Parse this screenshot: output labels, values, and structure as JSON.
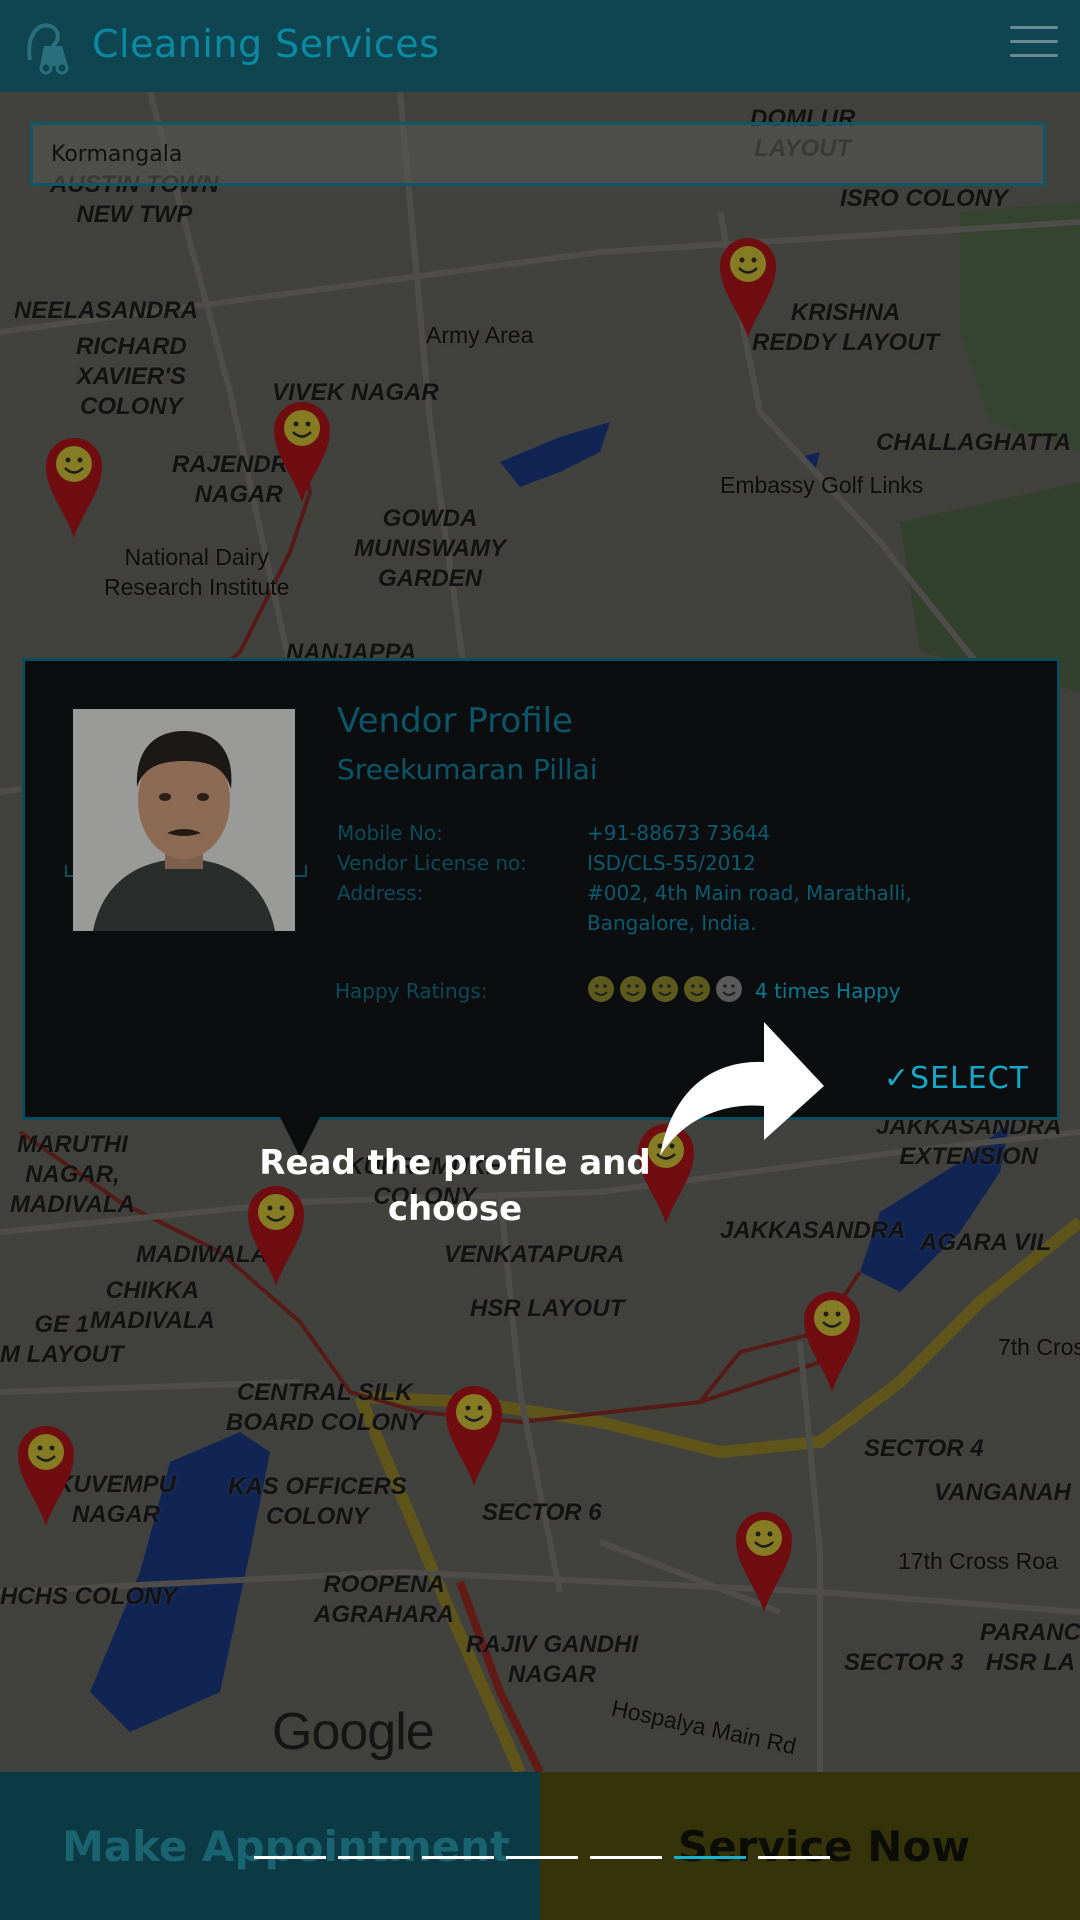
{
  "header": {
    "title": "Cleaning Services"
  },
  "search": {
    "value": "Kormangala"
  },
  "map": {
    "labels": [
      "AUSTIN TOWN\nNEW TWP",
      "ISRO COLONY",
      "DOMLUR\nLAYOUT",
      "NEELASANDRA",
      "RICHARD\nXAVIER'S\nCOLONY",
      "Army Area",
      "KRISHNA\nREDDY LAYOUT",
      "VIVEK NAGAR",
      "RAJENDRA\nNAGAR",
      "GOWDA\nMUNISWAMY\nGARDEN",
      "CHALLAGHATTA",
      "Embassy Golf Links",
      "National Dairy\nResearch Institute",
      "NANJAPPA",
      "MARUTHI\nNAGAR,\nMADIVALA",
      "MADIWALA",
      "CHIKKA\nMADIVALA",
      "KUDREMUKH\nCOLONY",
      "VENKATAPURA",
      "HSR LAYOUT",
      "JAKKASANDRA\nEXTENSION",
      "JAKKASANDRA",
      "AGARA VIL",
      "7th Cross",
      "CENTRAL SILK\nBOARD COLONY",
      "SECTOR 4",
      "VANGANAH",
      "KUVEMPU\nNAGAR",
      "KAS OFFICERS\nCOLONY",
      "SECTOR 6",
      "17th Cross Roa",
      "HCHS COLONY",
      "ROOPENA\nAGRAHARA",
      "PARANC\nHSR LA",
      "RAJIV GANDHI\nNAGAR",
      "SECTOR 3",
      "Hospalya Main Rd",
      "GE 1\nM LAYOUT"
    ],
    "attribution": "Google"
  },
  "vendor": {
    "heading": "Vendor Profile",
    "name": "Sreekumaran Pillai",
    "mobile_label": "Mobile No:",
    "mobile": "+91-88673 73644",
    "license_label": "Vendor License no:",
    "license": "ISD/CLS-55/2012",
    "address_label": "Address:",
    "address_line1": "#002, 4th Main road, Marathalli,",
    "address_line2": "Bangalore, India.",
    "ratings_label": "Happy Ratings:",
    "rating": 4,
    "rating_max": 5,
    "rating_text": "4 times Happy",
    "select_label": "✓SELECT"
  },
  "tutorial": {
    "hint": "Read the profile and choose",
    "current_step": 6,
    "total_steps": 7
  },
  "bottom": {
    "left_label": "Make Appointment",
    "right_label": "Service Now"
  },
  "colors": {
    "header": "#0f4550",
    "accent": "#15a7c8",
    "pin": "#b3151b",
    "appointment_bg": "#0c3a44",
    "service_bg": "#35330a"
  }
}
